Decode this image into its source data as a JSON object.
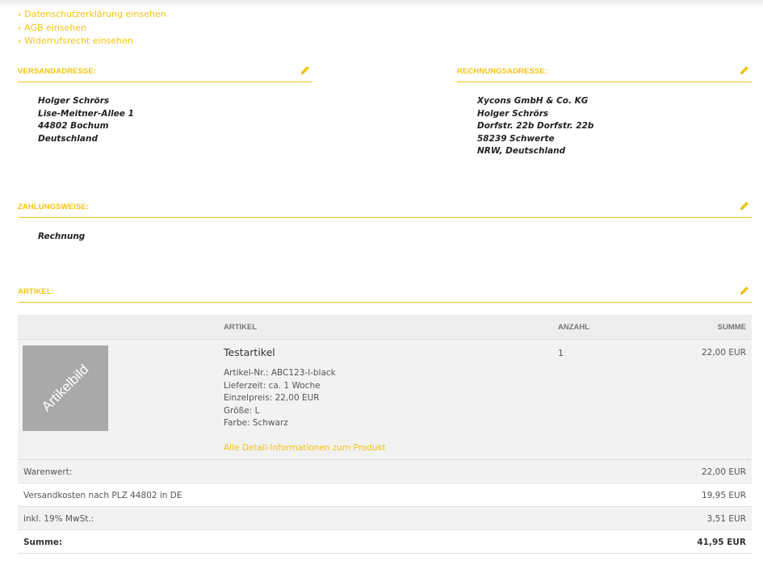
{
  "links": [
    {
      "label": "Datenschutzerklärung einsehen"
    },
    {
      "label": "AGB einsehen"
    },
    {
      "label": "Widerrufsrecht einsehen"
    }
  ],
  "shipping": {
    "title": "VERSANDADRESSE:",
    "lines": [
      "Holger Schrörs",
      "Lise-Meitner-Allee 1",
      "44802 Bochum",
      "Deutschland"
    ]
  },
  "billing": {
    "title": "RECHNUNGSADRESSE:",
    "lines": [
      "Xycons GmbH & Co. KG",
      "Holger Schrörs",
      "Dorfstr. 22b Dorfstr. 22b",
      "58239 Schwerte",
      "NRW, Deutschland"
    ]
  },
  "payment": {
    "title": "ZAHLUNGSWEISE:",
    "method": "Rechnung"
  },
  "articles": {
    "title": "ARTIKEL:",
    "headers": {
      "article": "ARTIKEL",
      "quantity": "ANZAHL",
      "sum": "SUMME"
    },
    "item": {
      "image_text": "Artikelbild",
      "name": "Testartikel",
      "details": [
        "Artikel-Nr.: ABC123-l-black",
        "Lieferzeit: ca. 1 Woche",
        "Einzelpreis: 22,00 EUR",
        "Größe: L",
        "Farbe: Schwarz"
      ],
      "detail_link": "Alle Detail-Informationen zum Produkt",
      "quantity": "1",
      "sum": "22,00 EUR"
    },
    "totals": [
      {
        "label": "Warenwert:",
        "value": "22,00 EUR"
      },
      {
        "label": "Versandkosten nach PLZ 44802 in DE",
        "value": "19,95 EUR"
      },
      {
        "label": "inkl. 19% MwSt.:",
        "value": "3,51 EUR"
      },
      {
        "label": "Summe:",
        "value": "41,95 EUR"
      }
    ]
  },
  "colors": {
    "accent": "#f4c40f",
    "row_bg": "#f2f2f2",
    "thumb_bg": "#a9a9a9"
  },
  "icons": {
    "edit": "pencil-icon",
    "link_bullet": "chevron-right-icon"
  }
}
